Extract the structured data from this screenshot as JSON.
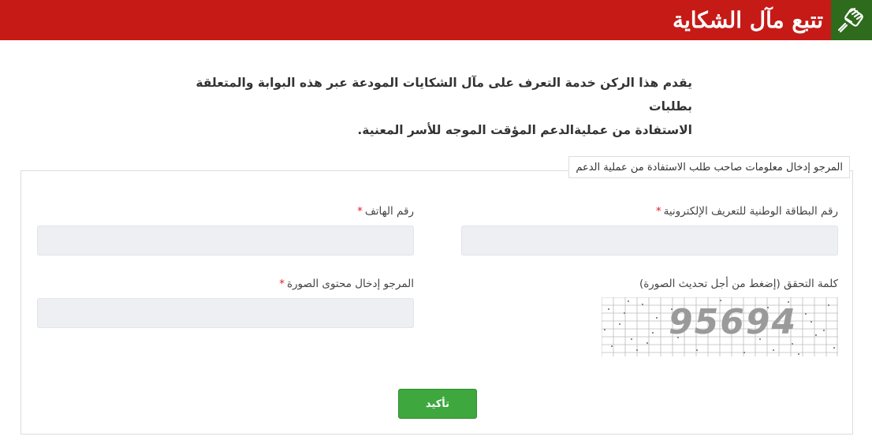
{
  "header": {
    "title": "تتبع مآل الشكاية",
    "logo_icon": "raised-fist-icon",
    "bar_color": "#c61a17",
    "logo_bg_color": "#2e6b1d"
  },
  "intro": {
    "line1": "يقدم هذا الركن خدمة التعرف على مآل الشكايات المودعة عبر هذه البوابة والمتعلقة بطلبات",
    "line2": "الاستفادة من عمليةالدعم المؤقت الموجه للأسر المعنية."
  },
  "form": {
    "legend": "المرجو إدخال معلومات صاحب طلب الاستفادة من عملية الدعم",
    "cin_label": "رقم البطاقة الوطنية للتعريف الإلكترونية",
    "phone_label": "رقم الهاتف",
    "captcha_label": "كلمة التحقق (إضغط من أجل تحديث الصورة)",
    "captcha_code": "95694",
    "captcha_input_label": "المرجو إدخال محتوى الصورة",
    "required_mark": "*",
    "cin_value": "",
    "phone_value": "",
    "captcha_value": "",
    "submit_label": "تأكيد",
    "submit_color": "#3ea83e"
  }
}
